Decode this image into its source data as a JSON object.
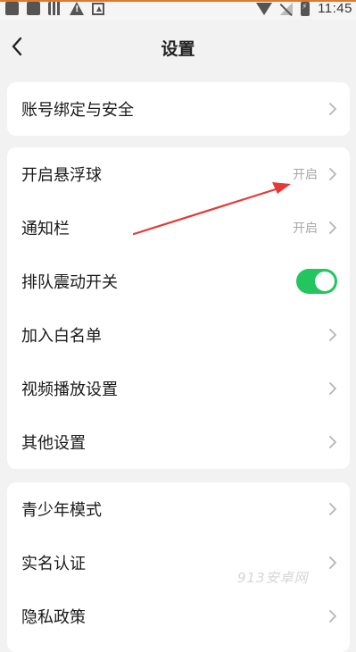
{
  "status_bar": {
    "time": "11:45",
    "accent_color": "#e07a2b",
    "icons": [
      "notification-icon",
      "notification-icon",
      "notification-icon",
      "warning-icon",
      "notification-icon",
      "wifi-icon",
      "signal-icon",
      "battery-icon"
    ]
  },
  "header": {
    "title": "设置",
    "back_icon": "chevron-left-icon"
  },
  "groups": [
    {
      "items": [
        {
          "label": "账号绑定与安全",
          "value": "",
          "control": "chevron"
        }
      ]
    },
    {
      "items": [
        {
          "label": "开启悬浮球",
          "value": "开启",
          "control": "chevron"
        },
        {
          "label": "通知栏",
          "value": "开启",
          "control": "chevron"
        },
        {
          "label": "排队震动开关",
          "value": "",
          "control": "toggle",
          "toggle_on": true
        },
        {
          "label": "加入白名单",
          "value": "",
          "control": "chevron"
        },
        {
          "label": "视频播放设置",
          "value": "",
          "control": "chevron"
        },
        {
          "label": "其他设置",
          "value": "",
          "control": "chevron"
        }
      ]
    },
    {
      "items": [
        {
          "label": "青少年模式",
          "value": "",
          "control": "chevron"
        },
        {
          "label": "实名认证",
          "value": "",
          "control": "chevron"
        },
        {
          "label": "隐私政策",
          "value": "",
          "control": "chevron"
        }
      ]
    }
  ],
  "colors": {
    "background": "#f2f2f2",
    "card": "#ffffff",
    "toggle_on": "#22c55e",
    "annotation_arrow": "#e53935"
  },
  "watermark": "913安卓网"
}
